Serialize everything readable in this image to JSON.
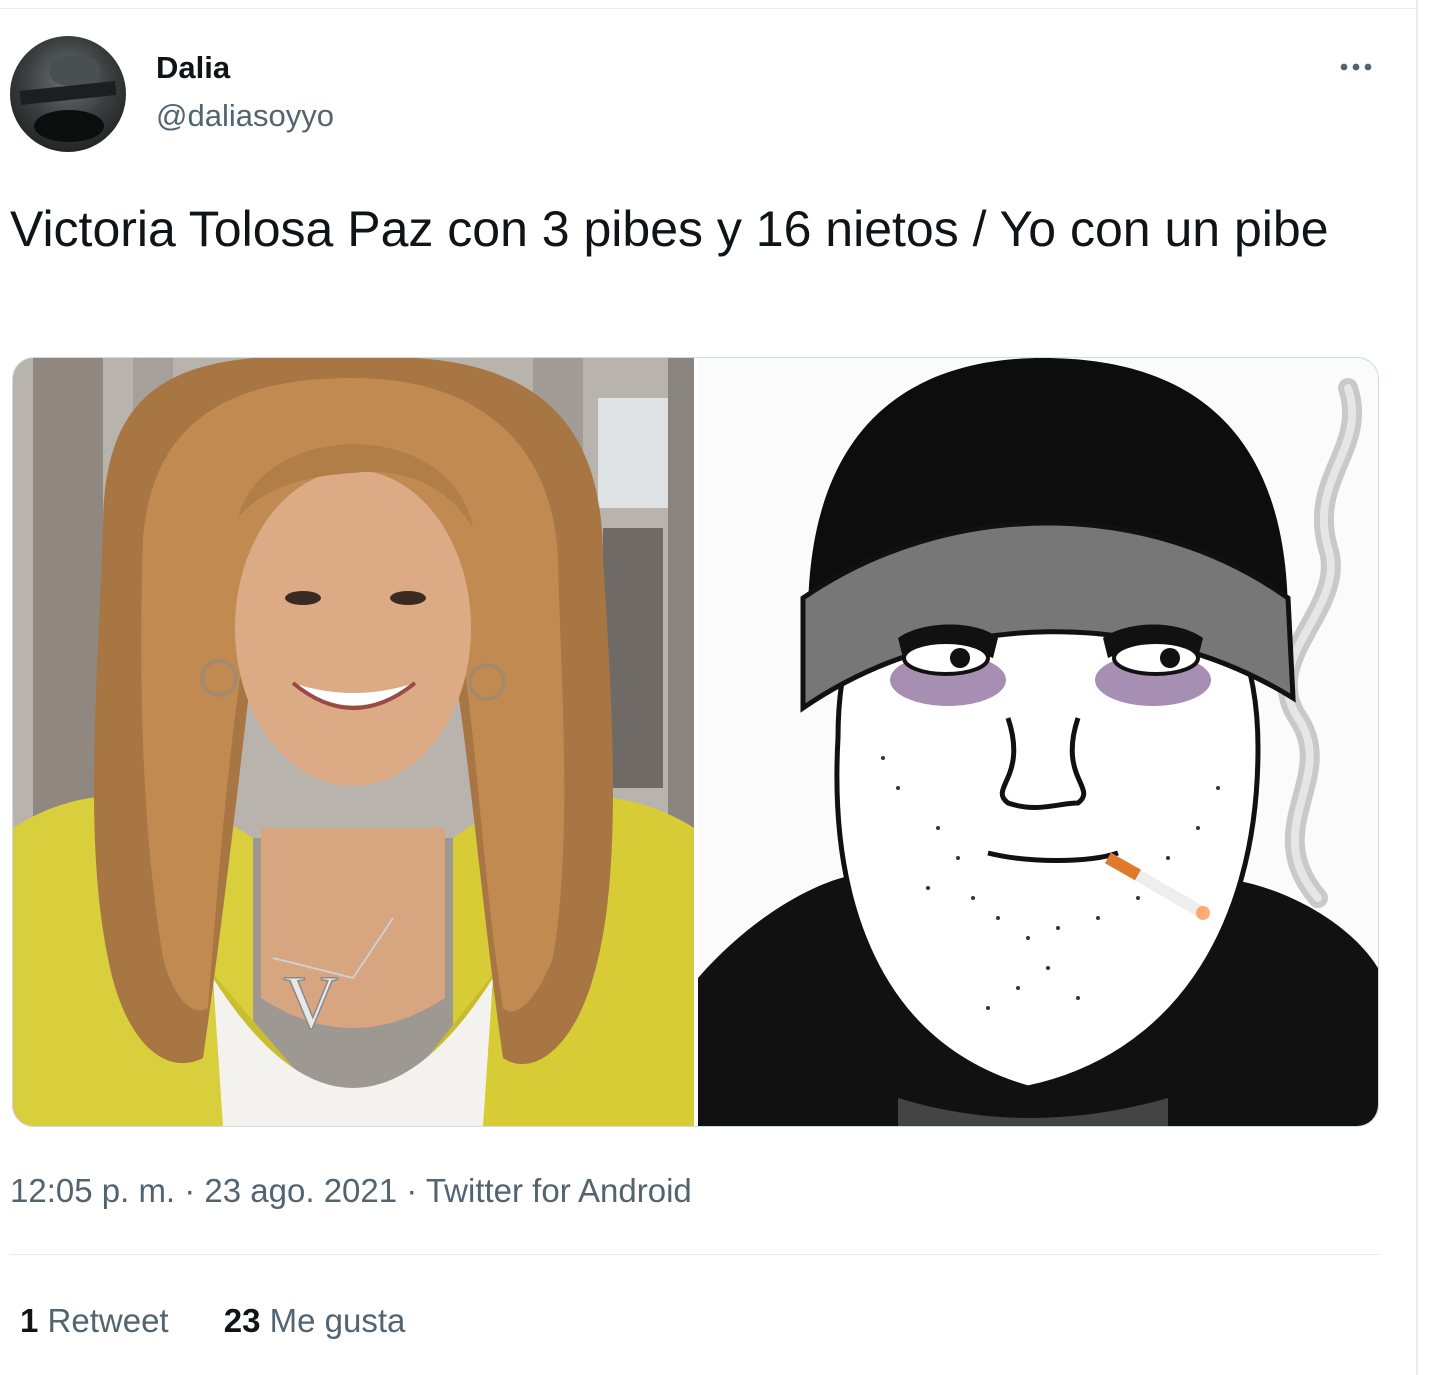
{
  "tweet": {
    "display_name": "Dalia",
    "handle": "@daliasoyyo",
    "text": "Victoria Tolosa Paz con 3 pibes y 16 nietos / Yo con un pibe",
    "timestamp": "12:05 p. m. · 23 ago. 2021 · Twitter for Android",
    "retweets_count": "1",
    "retweets_label": "Retweet",
    "likes_count": "23",
    "likes_label": "Me gusta"
  },
  "media": {
    "left_image": "portrait-photo",
    "right_image": "cartoon-illustration",
    "necklace_letter": "V"
  },
  "icons": {
    "more": "more-horizontal-icon"
  },
  "colors": {
    "text_primary": "#0f1419",
    "text_secondary": "#536471",
    "border": "#e6ecf0"
  }
}
